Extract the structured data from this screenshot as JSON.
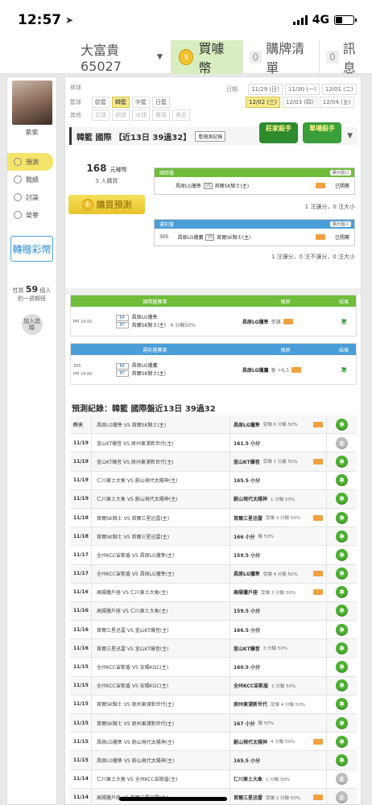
{
  "status": {
    "time": "12:57",
    "network": "4G"
  },
  "nav": {
    "user": "大富貴65027",
    "buy_coins": "買噱幣",
    "cart_label": "購牌清單",
    "cart_count": "0",
    "msg_label": "訊息",
    "msg_count": "0"
  },
  "sidebar": {
    "username": "紫紫",
    "menu": [
      "預測",
      "戰績",
      "討論",
      "榮譽"
    ],
    "gift": "轉贈彩幣",
    "fans_label_a": "性質",
    "fans_count": "59",
    "fans_label_b": "個人",
    "fans_sub": "約一週期徑",
    "add_track": "加入追蹤"
  },
  "filters": {
    "sport_label": "棒球",
    "league_label": "籃球",
    "other_label": "其他",
    "leagues": [
      "歐籃",
      "韓籃",
      "中籃",
      "日籃"
    ],
    "others": [
      "足球",
      "網球",
      "冰球",
      "賽馬",
      "美足"
    ],
    "date_label": "日期",
    "dates": [
      "11/29 (日)",
      "11/30 (一)",
      "12/01 (二)",
      "12/02 (三)",
      "12/03 (四)",
      "12/04 (五)"
    ]
  },
  "title": {
    "text": "韓籃 國際 【近13日 39過32】",
    "record_btn": "看預測記錄",
    "badge1": "莊家殺手",
    "badge2": "單場殺手"
  },
  "buy": {
    "price": "168",
    "unit": "元噱幣",
    "buyers": "5 人購買",
    "btn": "購買預測"
  },
  "intl_panel": {
    "header": "國際盤",
    "btn": "顯示盤口",
    "home": "昌原LG獵隼",
    "away": "首爾SK騎士(主)",
    "status": "已開賽",
    "note": "1 注讓分，0 注大小"
  },
  "ts_panel": {
    "header": "運彩盤",
    "btn": "顯示盤口",
    "id": "305",
    "home": "昌原LG獵鷹",
    "away": "首爾SK騎士(主)",
    "status": "已開賽",
    "note": "1 注讓分，0 注不讓分，0 注大小"
  },
  "intl_table": {
    "headers": [
      "國際盤賽事",
      "預測",
      "結果"
    ],
    "time": "PM 18:00",
    "o1": "84",
    "o2": "87",
    "home": "昌原LG獵隼",
    "away": "首爾SK騎士(主)",
    "spread": "6 分輸50%",
    "pick": "昌原LG獵隼",
    "pick_type": "受讓",
    "result": "準"
  },
  "ts_table": {
    "headers": [
      "運彩盤賽事",
      "預測",
      "結果"
    ],
    "id": "305",
    "time": "PM 18:00",
    "o1": "84",
    "o2": "87",
    "home": "昌原LG獵鷹",
    "away": "首爾SK騎士(主)",
    "pick": "昌原LG獵鷹",
    "pick_type": "客 +6.5",
    "result": "準"
  },
  "history": {
    "title": "預測紀錄：韓籃 國際盤近13日 39過32",
    "rows": [
      {
        "date": "昨天",
        "match": "昌原LG獵隼 VS 首爾SK騎士(主)",
        "pick": "昌原LG獵隼",
        "note": "受讓 6 分輸 50%",
        "result": "準",
        "tag": true
      },
      {
        "date": "11/19",
        "match": "釜山KT爆音 VS 原州東浦新世代(主)",
        "pick": "161.5 小分",
        "note": "",
        "result": "走",
        "tag": false
      },
      {
        "date": "11/19",
        "match": "釜山KT爆音 VS 原州東浦新世代(主)",
        "pick": "釜山KT爆音",
        "note": "受讓 1 分贏 50%",
        "result": "準",
        "tag": true
      },
      {
        "date": "11/19",
        "match": "仁川東土大象 VS 蔚山現代太陽神(主)",
        "pick": "165.5 小分",
        "note": "",
        "result": "準",
        "tag": false
      },
      {
        "date": "11/19",
        "match": "仁川東土大象 VS 蔚山現代太陽神(主)",
        "pick": "蔚山現代太陽神",
        "note": "1 分輸 50%",
        "result": "準",
        "tag": false
      },
      {
        "date": "11/18",
        "match": "首爾SK騎士 VS 首爾三星迅雷(主)",
        "pick": "首爾三星迅雷",
        "note": "受讓 3 分輸 50%",
        "result": "準",
        "tag": true
      },
      {
        "date": "11/18",
        "match": "首爾SK騎士 VS 首爾三星迅雷(主)",
        "pick": "166 小分",
        "note": "輸 50%",
        "result": "準",
        "tag": false
      },
      {
        "date": "11/17",
        "match": "全州KCC宙斯盾 VS 昌原LG獵隼(主)",
        "pick": "159.5 小分",
        "note": "",
        "result": "準",
        "tag": false
      },
      {
        "date": "11/17",
        "match": "全州KCC宙斯盾 VS 昌原LG獵隼(主)",
        "pick": "昌原LG獵隼",
        "note": "受讓 4 分輸 50%",
        "result": "準",
        "tag": true
      },
      {
        "date": "11/16",
        "match": "高陽獵戶座 VS 仁川東土大象(主)",
        "pick": "高陽獵戶座",
        "note": "受讓 3 分輸 50%",
        "result": "準",
        "tag": true
      },
      {
        "date": "11/16",
        "match": "高陽獵戶座 VS 仁川東土大象(主)",
        "pick": "159.5 小分",
        "note": "",
        "result": "準",
        "tag": false
      },
      {
        "date": "11/16",
        "match": "首爾三星迅雷 VS 釜山KT爆音(主)",
        "pick": "166.5 小分",
        "note": "",
        "result": "準",
        "tag": false
      },
      {
        "date": "11/16",
        "match": "首爾三星迅雷 VS 釜山KT爆音(主)",
        "pick": "釜山KT爆音",
        "note": "3 分輸 50%",
        "result": "準",
        "tag": false
      },
      {
        "date": "11/15",
        "match": "全州KCC宙斯盾 VS 安陽KGC(主)",
        "pick": "160.5 小分",
        "note": "",
        "result": "準",
        "tag": false
      },
      {
        "date": "11/15",
        "match": "全州KCC宙斯盾 VS 安陽KGC(主)",
        "pick": "全州KCC宙斯盾",
        "note": "1 分輸 50%",
        "result": "準",
        "tag": false
      },
      {
        "date": "11/15",
        "match": "首爾SK騎士 VS 原州東浦新世代(主)",
        "pick": "原州東浦新世代",
        "note": "受讓 4 分輸 50%",
        "result": "準",
        "tag": false
      },
      {
        "date": "11/15",
        "match": "首爾SK騎士 VS 原州東浦新世代(主)",
        "pick": "167 小分",
        "note": "輸 50%",
        "result": "準",
        "tag": false
      },
      {
        "date": "11/15",
        "match": "昌原LG獵隼 VS 蔚山現代太陽神(主)",
        "pick": "蔚山現代太陽神",
        "note": "4 分輸 50%",
        "result": "準",
        "tag": true
      },
      {
        "date": "11/15",
        "match": "昌原LG獵隼 VS 蔚山現代太陽神(主)",
        "pick": "165.5 小分",
        "note": "",
        "result": "準",
        "tag": false
      },
      {
        "date": "11/14",
        "match": "仁川東土大象 VS 全州KCC宙斯盾(主)",
        "pick": "仁川東土大象",
        "note": "1 分輸 50%",
        "result": "走",
        "tag": false
      },
      {
        "date": "11/14",
        "match": "高陽獵戶座 VS 首爾三星迅雷(主)",
        "pick": "首爾三星迅雷",
        "note": "受讓 2 分輸 50%",
        "result": "走",
        "tag": true
      }
    ]
  }
}
